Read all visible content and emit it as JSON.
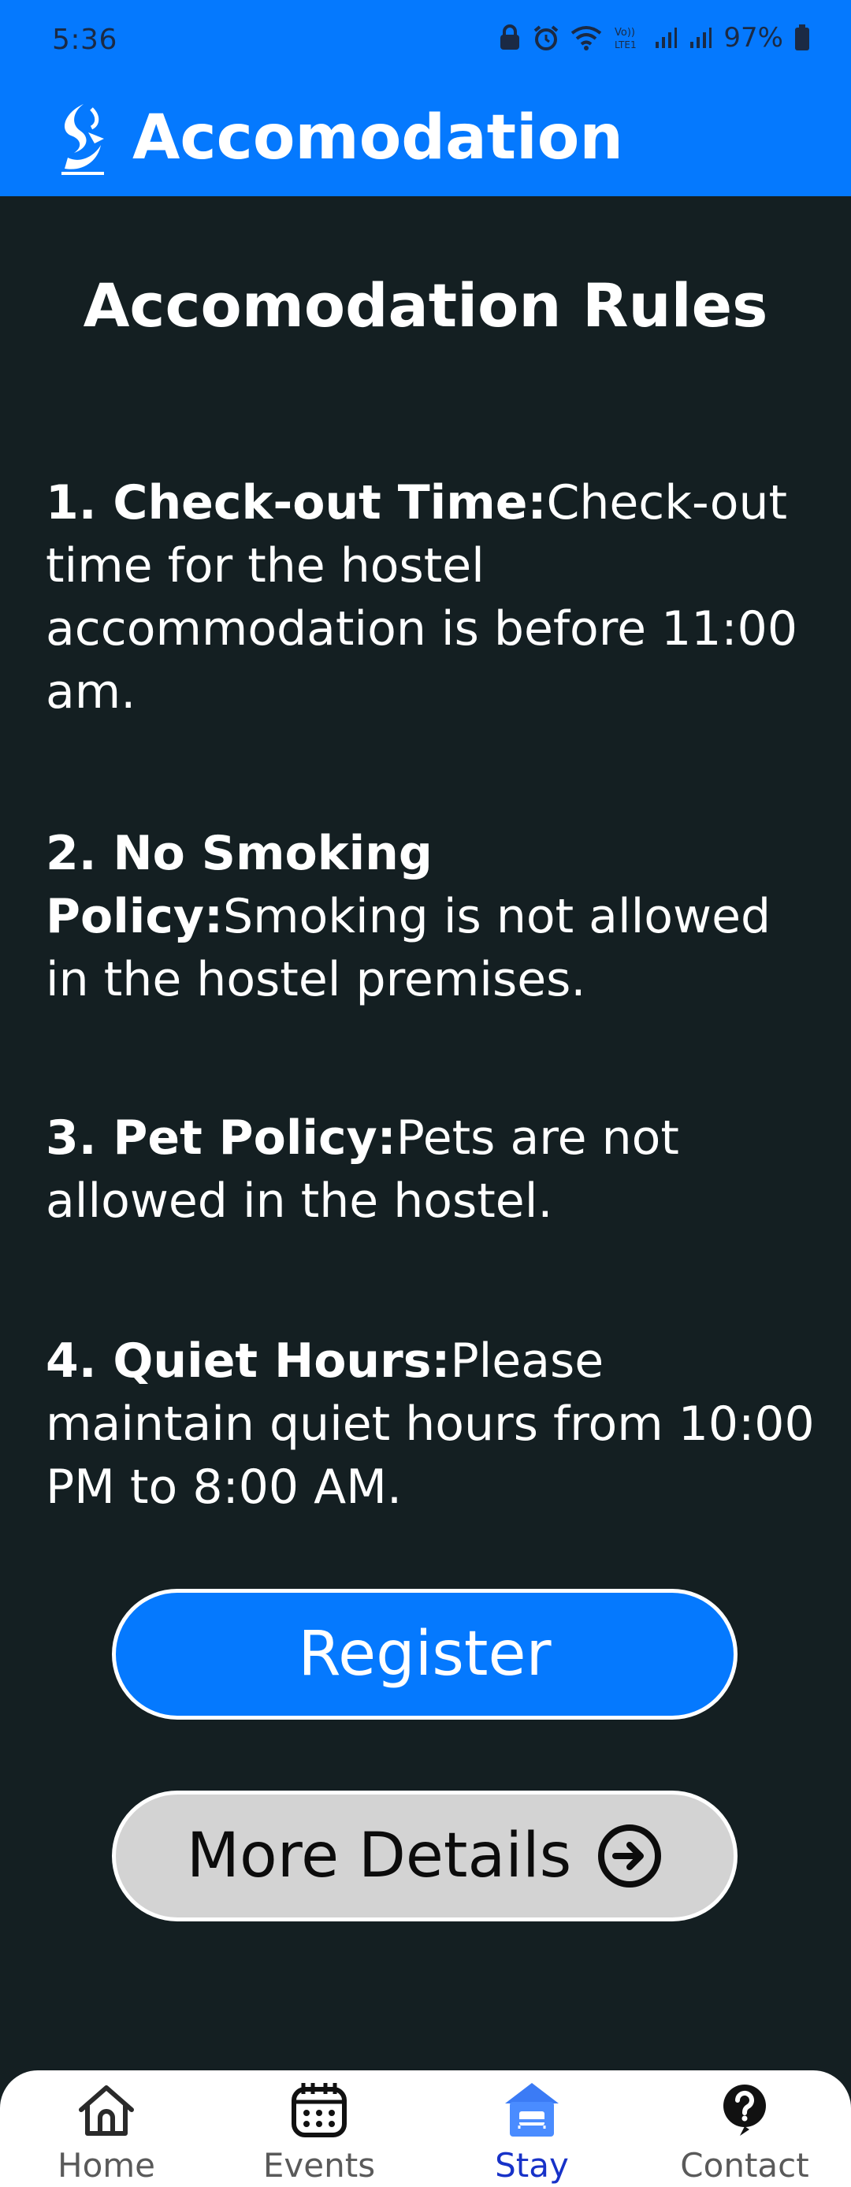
{
  "status_bar": {
    "time": "5:36",
    "battery": "97%",
    "icons": [
      "lock-icon",
      "alarm-icon",
      "wifi-icon",
      "volte-icon",
      "signal-icon",
      "signal-icon",
      "battery-icon"
    ]
  },
  "header": {
    "title": "Accomodation",
    "logo_icon": "institute-logo-icon"
  },
  "main": {
    "heading": "Accomodation Rules",
    "rules": [
      {
        "title": "1. Check-out Time:",
        "body": "Check-out time for the hostel accommodation is before 11:00 am."
      },
      {
        "title": "2. No Smoking Policy:",
        "body": "Smoking is not allowed in the hostel premises."
      },
      {
        "title": "3. Pet Policy:",
        "body": "Pets are not allowed in the hostel."
      },
      {
        "title": "4. Quiet Hours:",
        "body": "Please maintain quiet hours from 10:00 PM to 8:00 AM."
      }
    ],
    "register_label": "Register",
    "more_details_label": "More Details"
  },
  "bottom_nav": {
    "items": [
      {
        "label": "Home",
        "icon": "home-icon"
      },
      {
        "label": "Events",
        "icon": "calendar-icon"
      },
      {
        "label": "Stay",
        "icon": "hotel-icon",
        "active": true
      },
      {
        "label": "Contact",
        "icon": "help-icon"
      }
    ]
  },
  "colors": {
    "primary": "#0579fe",
    "background": "#141f22",
    "active_nav": "#1732c8",
    "secondary_button": "#d3d3d3"
  }
}
